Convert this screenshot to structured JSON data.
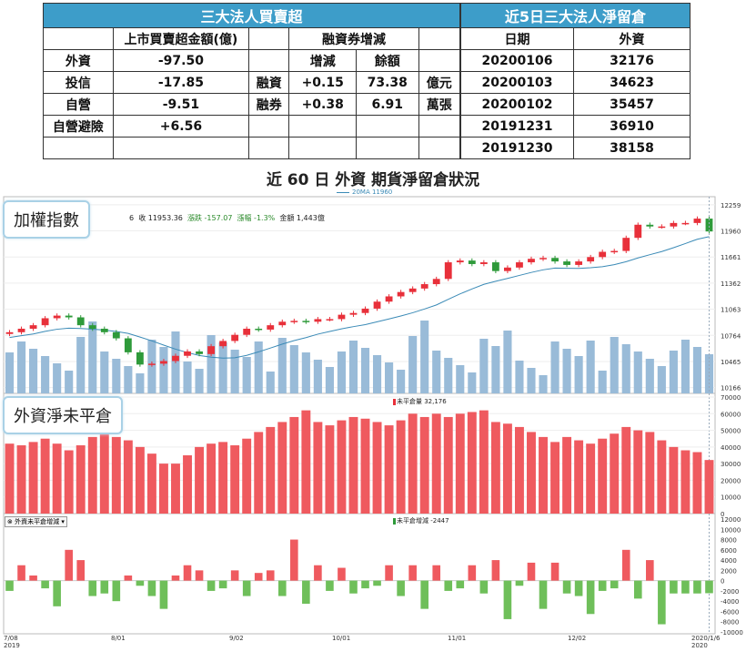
{
  "inst_table": {
    "title": "三大法人買賣超",
    "col_amount": "上市買賣超金額(億)",
    "col_margin": "融資券增減",
    "sub_change": "增減",
    "sub_balance": "餘額",
    "rows": [
      {
        "name": "外資",
        "amount": "-97.50",
        "m_label": "",
        "change": "增減",
        "balance": "餘額",
        "unit": ""
      },
      {
        "name": "投信",
        "amount": "-17.85",
        "m_label": "融資",
        "change": "+0.15",
        "balance": "73.38",
        "unit": "億元"
      },
      {
        "name": "自營",
        "amount": "-9.51",
        "m_label": "融券",
        "change": "+0.38",
        "balance": "6.91",
        "unit": "萬張"
      },
      {
        "name": "自營避險",
        "amount": "+6.56",
        "m_label": "",
        "change": "",
        "balance": "",
        "unit": ""
      }
    ]
  },
  "net_table": {
    "title": "近5日三大法人淨留倉",
    "col_date": "日期",
    "col_foreign": "外資",
    "rows": [
      {
        "date": "20200106",
        "value": "32176"
      },
      {
        "date": "20200103",
        "value": "34623"
      },
      {
        "date": "20200102",
        "value": "35457"
      },
      {
        "date": "20191231",
        "value": "36910"
      },
      {
        "date": "20191230",
        "value": "38158"
      }
    ]
  },
  "page_title": "近 60 日 外資 期貨淨留倉狀況",
  "ma_legend": "20MA 11960",
  "panel_labels": {
    "index": "加權指數",
    "oi": "外資淨未平倉"
  },
  "info_bar": {
    "prefix": "6",
    "close": "收 11953.36",
    "change": "漲跌 -157.07",
    "pct": "漲幅 -1.3%",
    "amount": "金額 1,443億"
  },
  "oi_legend": "未平倉量 32,176",
  "chg_legend": "未平倉增減 -2447",
  "chg_selector": "外資未平倉增減",
  "colors": {
    "up": "#e8303a",
    "down": "#2e9a3a",
    "oi": "#ef5a5f",
    "volume": "#99bbd8",
    "ma": "#3a8ab6",
    "header": "#3d9dc9"
  },
  "chart_data": [
    {
      "type": "candlestick",
      "title": "加權指數",
      "ylim": [
        10100,
        12330
      ],
      "y_ticks": [
        10166,
        10465,
        10764,
        11063,
        11362,
        11661,
        11960,
        12259
      ],
      "ohlc_approx_series": [
        10800,
        10840,
        10880,
        10960,
        10990,
        10970,
        10880,
        10840,
        10800,
        10730,
        10570,
        10430,
        10440,
        10470,
        10530,
        10580,
        10550,
        10640,
        10700,
        10770,
        10840,
        10830,
        10880,
        10920,
        10930,
        10920,
        10950,
        10950,
        11000,
        11020,
        11070,
        11150,
        11210,
        11260,
        11300,
        11350,
        11410,
        11600,
        11620,
        11580,
        11600,
        11500,
        11540,
        11600,
        11640,
        11650,
        11610,
        11570,
        11610,
        11660,
        11720,
        11730,
        11880,
        12030,
        12010,
        12010,
        12050,
        12050,
        12100,
        11953
      ],
      "last_close": 11953.36,
      "change": -157.07,
      "ma20_last": 11960,
      "volume_note": "金額 1,443億",
      "x_ticks": [
        "7/08 2019",
        "8/01",
        "9/02",
        "10/01",
        "11/01",
        "12/02",
        "2020/1/6"
      ]
    },
    {
      "type": "bar",
      "title": "外資淨未平倉",
      "series_name": "未平倉量",
      "ylim": [
        0,
        70000
      ],
      "y_ticks": [
        10000,
        20000,
        30000,
        40000,
        50000,
        60000,
        70000
      ],
      "values": [
        42000,
        41000,
        43000,
        45000,
        42000,
        38000,
        41000,
        46000,
        48000,
        46000,
        44000,
        40000,
        36000,
        30000,
        30000,
        35000,
        40000,
        42000,
        43000,
        41000,
        45000,
        49000,
        52000,
        55000,
        58000,
        62000,
        55000,
        53000,
        56000,
        58000,
        57000,
        55000,
        53000,
        56000,
        60000,
        58000,
        60000,
        58000,
        60000,
        61000,
        62000,
        55000,
        54000,
        52000,
        49000,
        46000,
        43000,
        46000,
        44000,
        42000,
        45000,
        48000,
        52000,
        50000,
        49000,
        44000,
        40000,
        38000,
        36910,
        32176
      ],
      "last_value": 32176
    },
    {
      "type": "bar",
      "title": "外資未平倉增減",
      "series_name": "未平倉增減",
      "ylim": [
        -10000,
        12000
      ],
      "y_ticks": [
        -10000,
        -8000,
        -6000,
        -4000,
        -2000,
        0,
        2000,
        4000,
        6000,
        8000,
        10000,
        12000
      ],
      "values": [
        -2000,
        3000,
        1000,
        -1500,
        -5000,
        6000,
        4000,
        -3000,
        -2500,
        -4000,
        1000,
        -1000,
        -3000,
        -5500,
        1000,
        3000,
        2000,
        -2000,
        -1500,
        2000,
        -3000,
        1500,
        2000,
        -3000,
        8000,
        -4500,
        3000,
        -2000,
        2500,
        -2500,
        -1500,
        -1000,
        3000,
        -3000,
        3000,
        -5500,
        3000,
        -2000,
        -1500,
        3000,
        -2500,
        4000,
        -7500,
        -1000,
        3500,
        -5500,
        3500,
        -2500,
        -3000,
        -6500,
        -2000,
        -1500,
        6000,
        -3500,
        4000,
        -8500,
        -2500,
        -2500,
        -2500,
        -2447
      ],
      "last_value": -2447
    }
  ]
}
